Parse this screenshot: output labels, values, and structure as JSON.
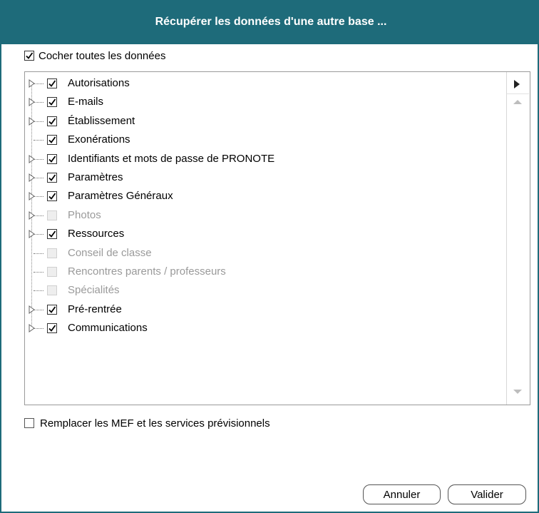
{
  "dialog": {
    "title": "Récupérer les données d'une autre base ...",
    "check_all": {
      "label": "Cocher toutes les données",
      "checked": true
    },
    "tree": {
      "items": [
        {
          "label": "Autorisations",
          "checked": true,
          "disabled": false,
          "expandable": true
        },
        {
          "label": "E-mails",
          "checked": true,
          "disabled": false,
          "expandable": true
        },
        {
          "label": "Établissement",
          "checked": true,
          "disabled": false,
          "expandable": true
        },
        {
          "label": "Exonérations",
          "checked": true,
          "disabled": false,
          "expandable": false
        },
        {
          "label": "Identifiants et mots de passe de PRONOTE",
          "checked": true,
          "disabled": false,
          "expandable": true
        },
        {
          "label": "Paramètres",
          "checked": true,
          "disabled": false,
          "expandable": true
        },
        {
          "label": "Paramètres Généraux",
          "checked": true,
          "disabled": false,
          "expandable": true
        },
        {
          "label": "Photos",
          "checked": false,
          "disabled": true,
          "expandable": true
        },
        {
          "label": "Ressources",
          "checked": true,
          "disabled": false,
          "expandable": true
        },
        {
          "label": "Conseil de classe",
          "checked": false,
          "disabled": true,
          "expandable": false
        },
        {
          "label": "Rencontres parents / professeurs",
          "checked": false,
          "disabled": true,
          "expandable": false
        },
        {
          "label": "Spécialités",
          "checked": false,
          "disabled": true,
          "expandable": false
        },
        {
          "label": "Pré-rentrée",
          "checked": true,
          "disabled": false,
          "expandable": true
        },
        {
          "label": "Communications",
          "checked": true,
          "disabled": false,
          "expandable": true
        }
      ]
    },
    "replace_option": {
      "label": "Remplacer les MEF et les services prévisionnels",
      "checked": false
    },
    "buttons": {
      "cancel_label": "Annuler",
      "ok_label": "Valider"
    },
    "colors": {
      "title_bar": "#1e6b7a",
      "title_text": "#ffffff",
      "disabled_text": "#9a9a9a"
    },
    "icons": {
      "expander": "triangle-right-outline-icon",
      "scroll_expand": "triangle-right-filled-icon",
      "scroll_up": "triangle-up-icon",
      "scroll_down": "triangle-down-icon",
      "checkmark": "checkmark-icon"
    }
  }
}
